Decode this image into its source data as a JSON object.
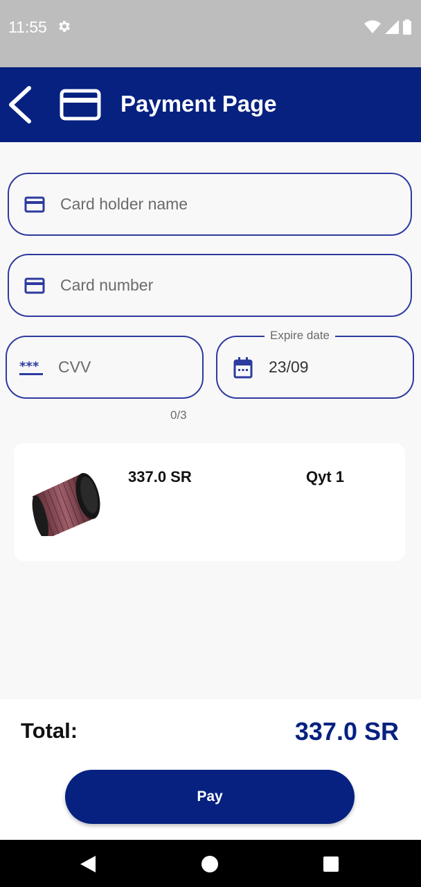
{
  "status_bar": {
    "time": "11:55",
    "icons": [
      "settings-icon",
      "wifi-icon",
      "signal-icon",
      "battery-icon"
    ]
  },
  "app_bar": {
    "title": "Payment Page",
    "back_icon": "chevron-left-icon",
    "logo_icon": "credit-card-icon"
  },
  "form": {
    "card_holder": {
      "placeholder": "Card holder name",
      "icon": "credit-card-icon"
    },
    "card_number": {
      "placeholder": "Card number",
      "icon": "credit-card-icon"
    },
    "cvv": {
      "placeholder": "CVV",
      "icon": "password-dots-icon",
      "counter": "0/3"
    },
    "expire": {
      "label": "Expire date",
      "value": "23/09",
      "icon": "calendar-icon"
    }
  },
  "cart": {
    "items": [
      {
        "price": "337.0 SR",
        "qty": "Qyt 1",
        "image": "air-filter-image"
      }
    ]
  },
  "summary": {
    "total_label": "Total:",
    "total_value": "337.0 SR"
  },
  "actions": {
    "pay_label": "Pay"
  },
  "colors": {
    "primary": "#062180",
    "field_border": "#2d3a9e",
    "background": "#f8f8f9"
  }
}
